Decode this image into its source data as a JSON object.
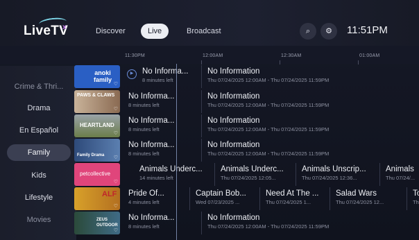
{
  "app": {
    "logo_text": "LiveTV",
    "logo_suffix": "x"
  },
  "nav": {
    "tabs": [
      "Discover",
      "Live",
      "Broadcast"
    ],
    "active": "Live"
  },
  "header": {
    "clock": "11:51PM",
    "search_glyph": "⌕",
    "settings_glyph": "⚙"
  },
  "timeline": {
    "labels": [
      "11:30PM",
      "12:00AM",
      "12:30AM",
      "01:00AM"
    ]
  },
  "sidebar": {
    "items": [
      "Crime & Thri...",
      "Drama",
      "En Español",
      "Family",
      "Kids",
      "Lifestyle",
      "Movies"
    ],
    "active": "Family"
  },
  "rows": [
    {
      "channel": "anoki family",
      "thumb_color": "#2a5fc4",
      "programs": [
        {
          "title": "No Informa...",
          "sub": "8 minutes left"
        },
        {
          "title": "No Information",
          "sub": "Thu 07/24/2025 12:00AM - Thu 07/24/2025 11:59PM"
        }
      ]
    },
    {
      "channel": "PAWS & CLAWS",
      "thumb_color": "#8a6a52",
      "programs": [
        {
          "title": "No Informa...",
          "sub": "8 minutes left"
        },
        {
          "title": "No Information",
          "sub": "Thu 07/24/2025 12:00AM - Thu 07/24/2025 11:59PM"
        }
      ]
    },
    {
      "channel": "HEARTLAND",
      "thumb_color": "#6b7d4a",
      "programs": [
        {
          "title": "No Informa...",
          "sub": "8 minutes left"
        },
        {
          "title": "No Information",
          "sub": "Thu 07/24/2025 12:00AM - Thu 07/24/2025 11:59PM"
        }
      ]
    },
    {
      "channel": "Family Drama",
      "thumb_color": "#2e4a7a",
      "programs": [
        {
          "title": "No Informa...",
          "sub": "8 minutes left"
        },
        {
          "title": "No Information",
          "sub": "Thu 07/24/2025 12:00AM - Thu 07/24/2025 11:59PM"
        }
      ]
    },
    {
      "channel": "petcollective",
      "thumb_color": "#e0457b",
      "programs": [
        {
          "title": "Animals Underc...",
          "sub": "14 minutes left"
        },
        {
          "title": "Animals Underc...",
          "sub": "Thu 07/24/2025 12:05..."
        },
        {
          "title": "Animals Unscrip...",
          "sub": "Thu 07/24/2025 12:36..."
        },
        {
          "title": "Animals",
          "sub": "Thu 07/24/..."
        }
      ]
    },
    {
      "channel": "ALF",
      "thumb_color": "#d8a12a",
      "programs": [
        {
          "title": "Pride Of...",
          "sub": "4 minutes left"
        },
        {
          "title": "Captain Bob...",
          "sub": "Wed 07/23/2025 ..."
        },
        {
          "title": "Need At The ...",
          "sub": "Thu 07/24/2025 1..."
        },
        {
          "title": "Salad Wars",
          "sub": "Thu 07/24/2025 12..."
        },
        {
          "title": "To",
          "sub": "Thu"
        }
      ]
    },
    {
      "channel": "ZEUS OUTDOOR",
      "thumb_color": "#3f6b86",
      "programs": [
        {
          "title": "No Informa...",
          "sub": "8 minutes left"
        },
        {
          "title": "No Information",
          "sub": "Thu 07/24/2025 12:00AM - Thu 07/24/2025 11:59PM"
        }
      ]
    }
  ]
}
